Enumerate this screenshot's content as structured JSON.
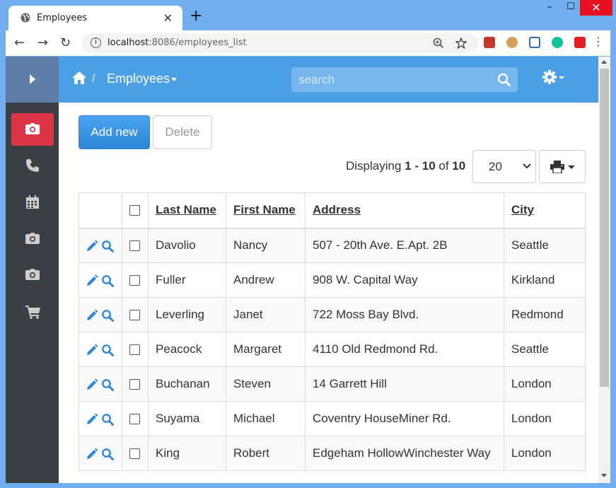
{
  "browser": {
    "tab_title": "Employees",
    "new_tab": "+",
    "controls": {
      "minimize": "–",
      "maximize": "☐",
      "close": "✕"
    },
    "url_host": "localhost",
    "url_path": ":8086/employees_list",
    "menu": "⋮"
  },
  "header": {
    "breadcrumb_sep": "/",
    "breadcrumb": "Employees",
    "search_placeholder": "search"
  },
  "toolbar": {
    "add_label": "Add new",
    "delete_label": "Delete",
    "display_prefix": "Displaying ",
    "display_from": "1",
    "display_dash": " - ",
    "display_to": "10",
    "display_of": " of ",
    "display_total": "10",
    "page_size": "20"
  },
  "sidebar": {
    "items": [
      {
        "icon": "camera-icon",
        "active": true
      },
      {
        "icon": "phone-icon",
        "active": false
      },
      {
        "icon": "calendar-icon",
        "active": false
      },
      {
        "icon": "camera-icon",
        "active": false
      },
      {
        "icon": "camera-icon",
        "active": false
      },
      {
        "icon": "cart-icon",
        "active": false
      }
    ]
  },
  "table": {
    "columns": [
      "Last Name",
      "First Name",
      "Address",
      "City"
    ],
    "rows": [
      [
        "Davolio",
        "Nancy",
        "507 - 20th Ave. E.Apt. 2B",
        "Seattle"
      ],
      [
        "Fuller",
        "Andrew",
        "908 W. Capital Way",
        "Kirkland"
      ],
      [
        "Leverling",
        "Janet",
        "722 Moss Bay Blvd.",
        "Redmond"
      ],
      [
        "Peacock",
        "Margaret",
        "4110 Old Redmond Rd.",
        "Seattle"
      ],
      [
        "Buchanan",
        "Steven",
        "14 Garrett Hill",
        "London"
      ],
      [
        "Suyama",
        "Michael",
        "Coventry HouseMiner Rd.",
        "London"
      ],
      [
        "King",
        "Robert",
        "Edgeham HollowWinchester Way",
        "London"
      ]
    ]
  },
  "colors": {
    "header_blue": "#4a9fe5",
    "sidebar_dark": "#3a3f46",
    "active_red": "#dc3545",
    "action_blue": "#2f86d6"
  }
}
